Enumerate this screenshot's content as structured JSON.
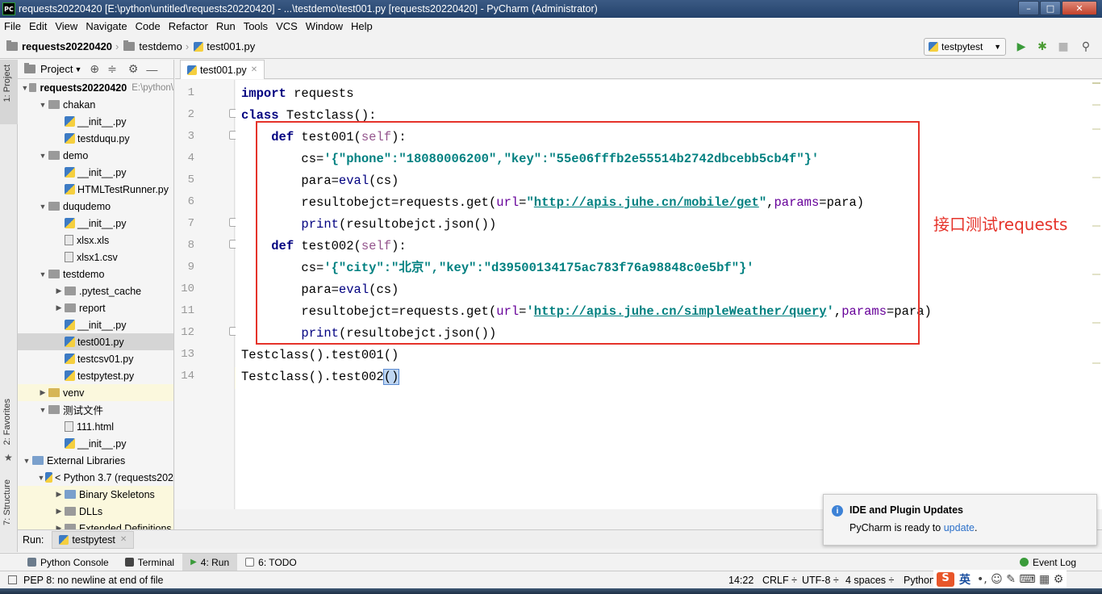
{
  "window": {
    "title": "requests20220420 [E:\\python\\untitled\\requests20220420] - ...\\testdemo\\test001.py [requests20220420] - PyCharm (Administrator)",
    "logo_text": "PC",
    "minimize": "–",
    "maximize": "□",
    "close": "✕"
  },
  "menu": [
    "File",
    "Edit",
    "View",
    "Navigate",
    "Code",
    "Refactor",
    "Run",
    "Tools",
    "VCS",
    "Window",
    "Help"
  ],
  "breadcrumb": {
    "project": "requests20220420",
    "folder": "testdemo",
    "file": "test001.py"
  },
  "toolbar": {
    "run_config": "testpytest",
    "run_icon": "play-icon",
    "debug_icon": "bug-icon",
    "stop_icon": "stop-icon",
    "search_icon": "search-icon"
  },
  "side_tabs": {
    "project": "1: Project",
    "favorites": "2: Favorites",
    "structure": "7: Structure"
  },
  "project_panel": {
    "title": "Project",
    "tree": [
      {
        "label": "requests20220420",
        "suffix": "E:\\python\\",
        "depth": 0,
        "type": "folder",
        "expanded": true,
        "bold": true
      },
      {
        "label": "chakan",
        "depth": 1,
        "type": "folder",
        "expanded": true
      },
      {
        "label": "__init__.py",
        "depth": 2,
        "type": "py"
      },
      {
        "label": "testduqu.py",
        "depth": 2,
        "type": "py"
      },
      {
        "label": "demo",
        "depth": 1,
        "type": "folder",
        "expanded": true
      },
      {
        "label": "__init__.py",
        "depth": 2,
        "type": "py"
      },
      {
        "label": "HTMLTestRunner.py",
        "depth": 2,
        "type": "py"
      },
      {
        "label": "duqudemo",
        "depth": 1,
        "type": "folder",
        "expanded": true
      },
      {
        "label": "__init__.py",
        "depth": 2,
        "type": "py"
      },
      {
        "label": "xlsx.xls",
        "depth": 2,
        "type": "file"
      },
      {
        "label": "xlsx1.csv",
        "depth": 2,
        "type": "file"
      },
      {
        "label": "testdemo",
        "depth": 1,
        "type": "folder",
        "expanded": true
      },
      {
        "label": ".pytest_cache",
        "depth": 2,
        "type": "folder",
        "expanded": false
      },
      {
        "label": "report",
        "depth": 2,
        "type": "folder",
        "expanded": false
      },
      {
        "label": "__init__.py",
        "depth": 2,
        "type": "py"
      },
      {
        "label": "test001.py",
        "depth": 2,
        "type": "py",
        "selected": true
      },
      {
        "label": "testcsv01.py",
        "depth": 2,
        "type": "py"
      },
      {
        "label": "testpytest.py",
        "depth": 2,
        "type": "py"
      },
      {
        "label": "venv",
        "depth": 1,
        "type": "folder-yellow",
        "expanded": false,
        "highlight": true
      },
      {
        "label": "测试文件",
        "depth": 1,
        "type": "folder",
        "expanded": true
      },
      {
        "label": "111.html",
        "depth": 2,
        "type": "file"
      },
      {
        "label": "__init__.py",
        "depth": 2,
        "type": "py"
      },
      {
        "label": "External Libraries",
        "depth": 0,
        "type": "lib",
        "expanded": true
      },
      {
        "label": "< Python 3.7 (requests202",
        "depth": 1,
        "type": "py",
        "expanded": true
      },
      {
        "label": "Binary Skeletons",
        "depth": 2,
        "type": "lib",
        "expanded": false,
        "highlight": true
      },
      {
        "label": "DLLs",
        "depth": 2,
        "type": "folder",
        "expanded": false,
        "highlight": true
      },
      {
        "label": "Extended Definitions",
        "depth": 2,
        "type": "folder",
        "expanded": false,
        "highlight": true
      }
    ]
  },
  "editor": {
    "tab": "test001.py",
    "line_numbers": [
      "1",
      "2",
      "3",
      "4",
      "5",
      "6",
      "7",
      "8",
      "9",
      "10",
      "11",
      "12",
      "13",
      "14"
    ],
    "annotation": "接口测试requests"
  },
  "run_panel": {
    "label": "Run:",
    "tab": "testpytest"
  },
  "tool_windows": [
    "Python Console",
    "Terminal",
    "4: Run",
    "6: TODO"
  ],
  "event_log": "Event Log",
  "notification": {
    "title": "IDE and Plugin Updates",
    "body": "PyCharm is ready to ",
    "link": "update",
    "end": "."
  },
  "status": {
    "message": "PEP 8: no newline at end of file",
    "position": "14:22",
    "line_sep": "CRLF ÷",
    "encoding": "UTF-8 ÷",
    "indent": "4 spaces ÷",
    "interpreter": "Python",
    "ime": "英"
  }
}
